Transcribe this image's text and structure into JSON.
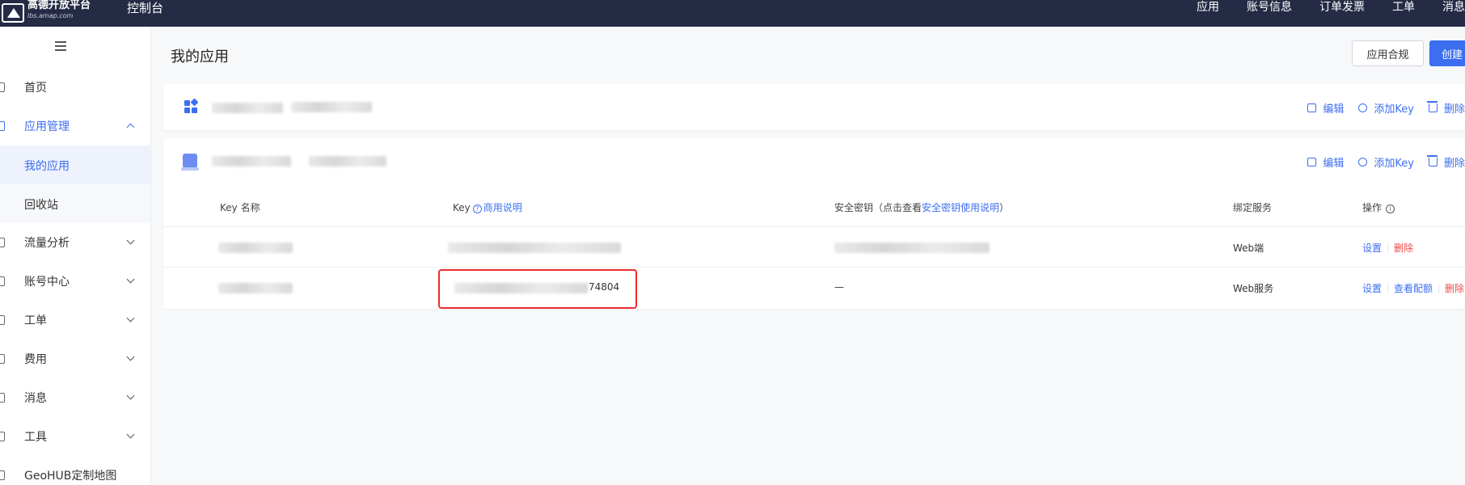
{
  "topbar": {
    "logo_name": "高德开放平台",
    "logo_sub": "lbs.amap.com",
    "console_title": "控制台",
    "nav": [
      "应用",
      "账号信息",
      "订单发票",
      "工单",
      "消息"
    ]
  },
  "sidebar": {
    "items": [
      {
        "label": "首页",
        "icon": "home-icon"
      },
      {
        "label": "应用管理",
        "icon": "app-icon",
        "expanded": true
      },
      {
        "label": "我的应用",
        "sub": true,
        "selected": true
      },
      {
        "label": "回收站",
        "sub": true
      },
      {
        "label": "流量分析",
        "icon": "chart-icon"
      },
      {
        "label": "账号中心",
        "icon": "user-icon"
      },
      {
        "label": "工单",
        "icon": "ticket-icon"
      },
      {
        "label": "费用",
        "icon": "fee-icon"
      },
      {
        "label": "消息",
        "icon": "bell-icon"
      },
      {
        "label": "工具",
        "icon": "tool-icon"
      },
      {
        "label": "GeoHUB定制地图",
        "icon": "map-icon"
      }
    ]
  },
  "main": {
    "page_title": "我的应用",
    "btn_compliance": "应用合规",
    "btn_create": "创建"
  },
  "card_actions": {
    "edit": "编辑",
    "add_key": "添加Key",
    "delete": "删除"
  },
  "table": {
    "headers": {
      "key_name": "Key 名称",
      "key": "Key",
      "key_link": "商用说明",
      "secret_prefix": "安全密钥（点击查看",
      "secret_link": "安全密钥使用说明",
      "secret_suffix": "）",
      "service": "绑定服务",
      "ops": "操作"
    },
    "rows": [
      {
        "key_suffix": "",
        "secret": "",
        "service": "Web端",
        "ops": [
          "设置",
          "删除"
        ]
      },
      {
        "key_suffix": "74804",
        "secret": "—",
        "service": "Web服务",
        "ops": [
          "设置",
          "查看配额",
          "删除"
        ]
      }
    ]
  },
  "colors": {
    "topbar": "#252b45",
    "accent": "#3c6ef0",
    "danger": "#f04848",
    "highlight": "#ee2c2c"
  }
}
